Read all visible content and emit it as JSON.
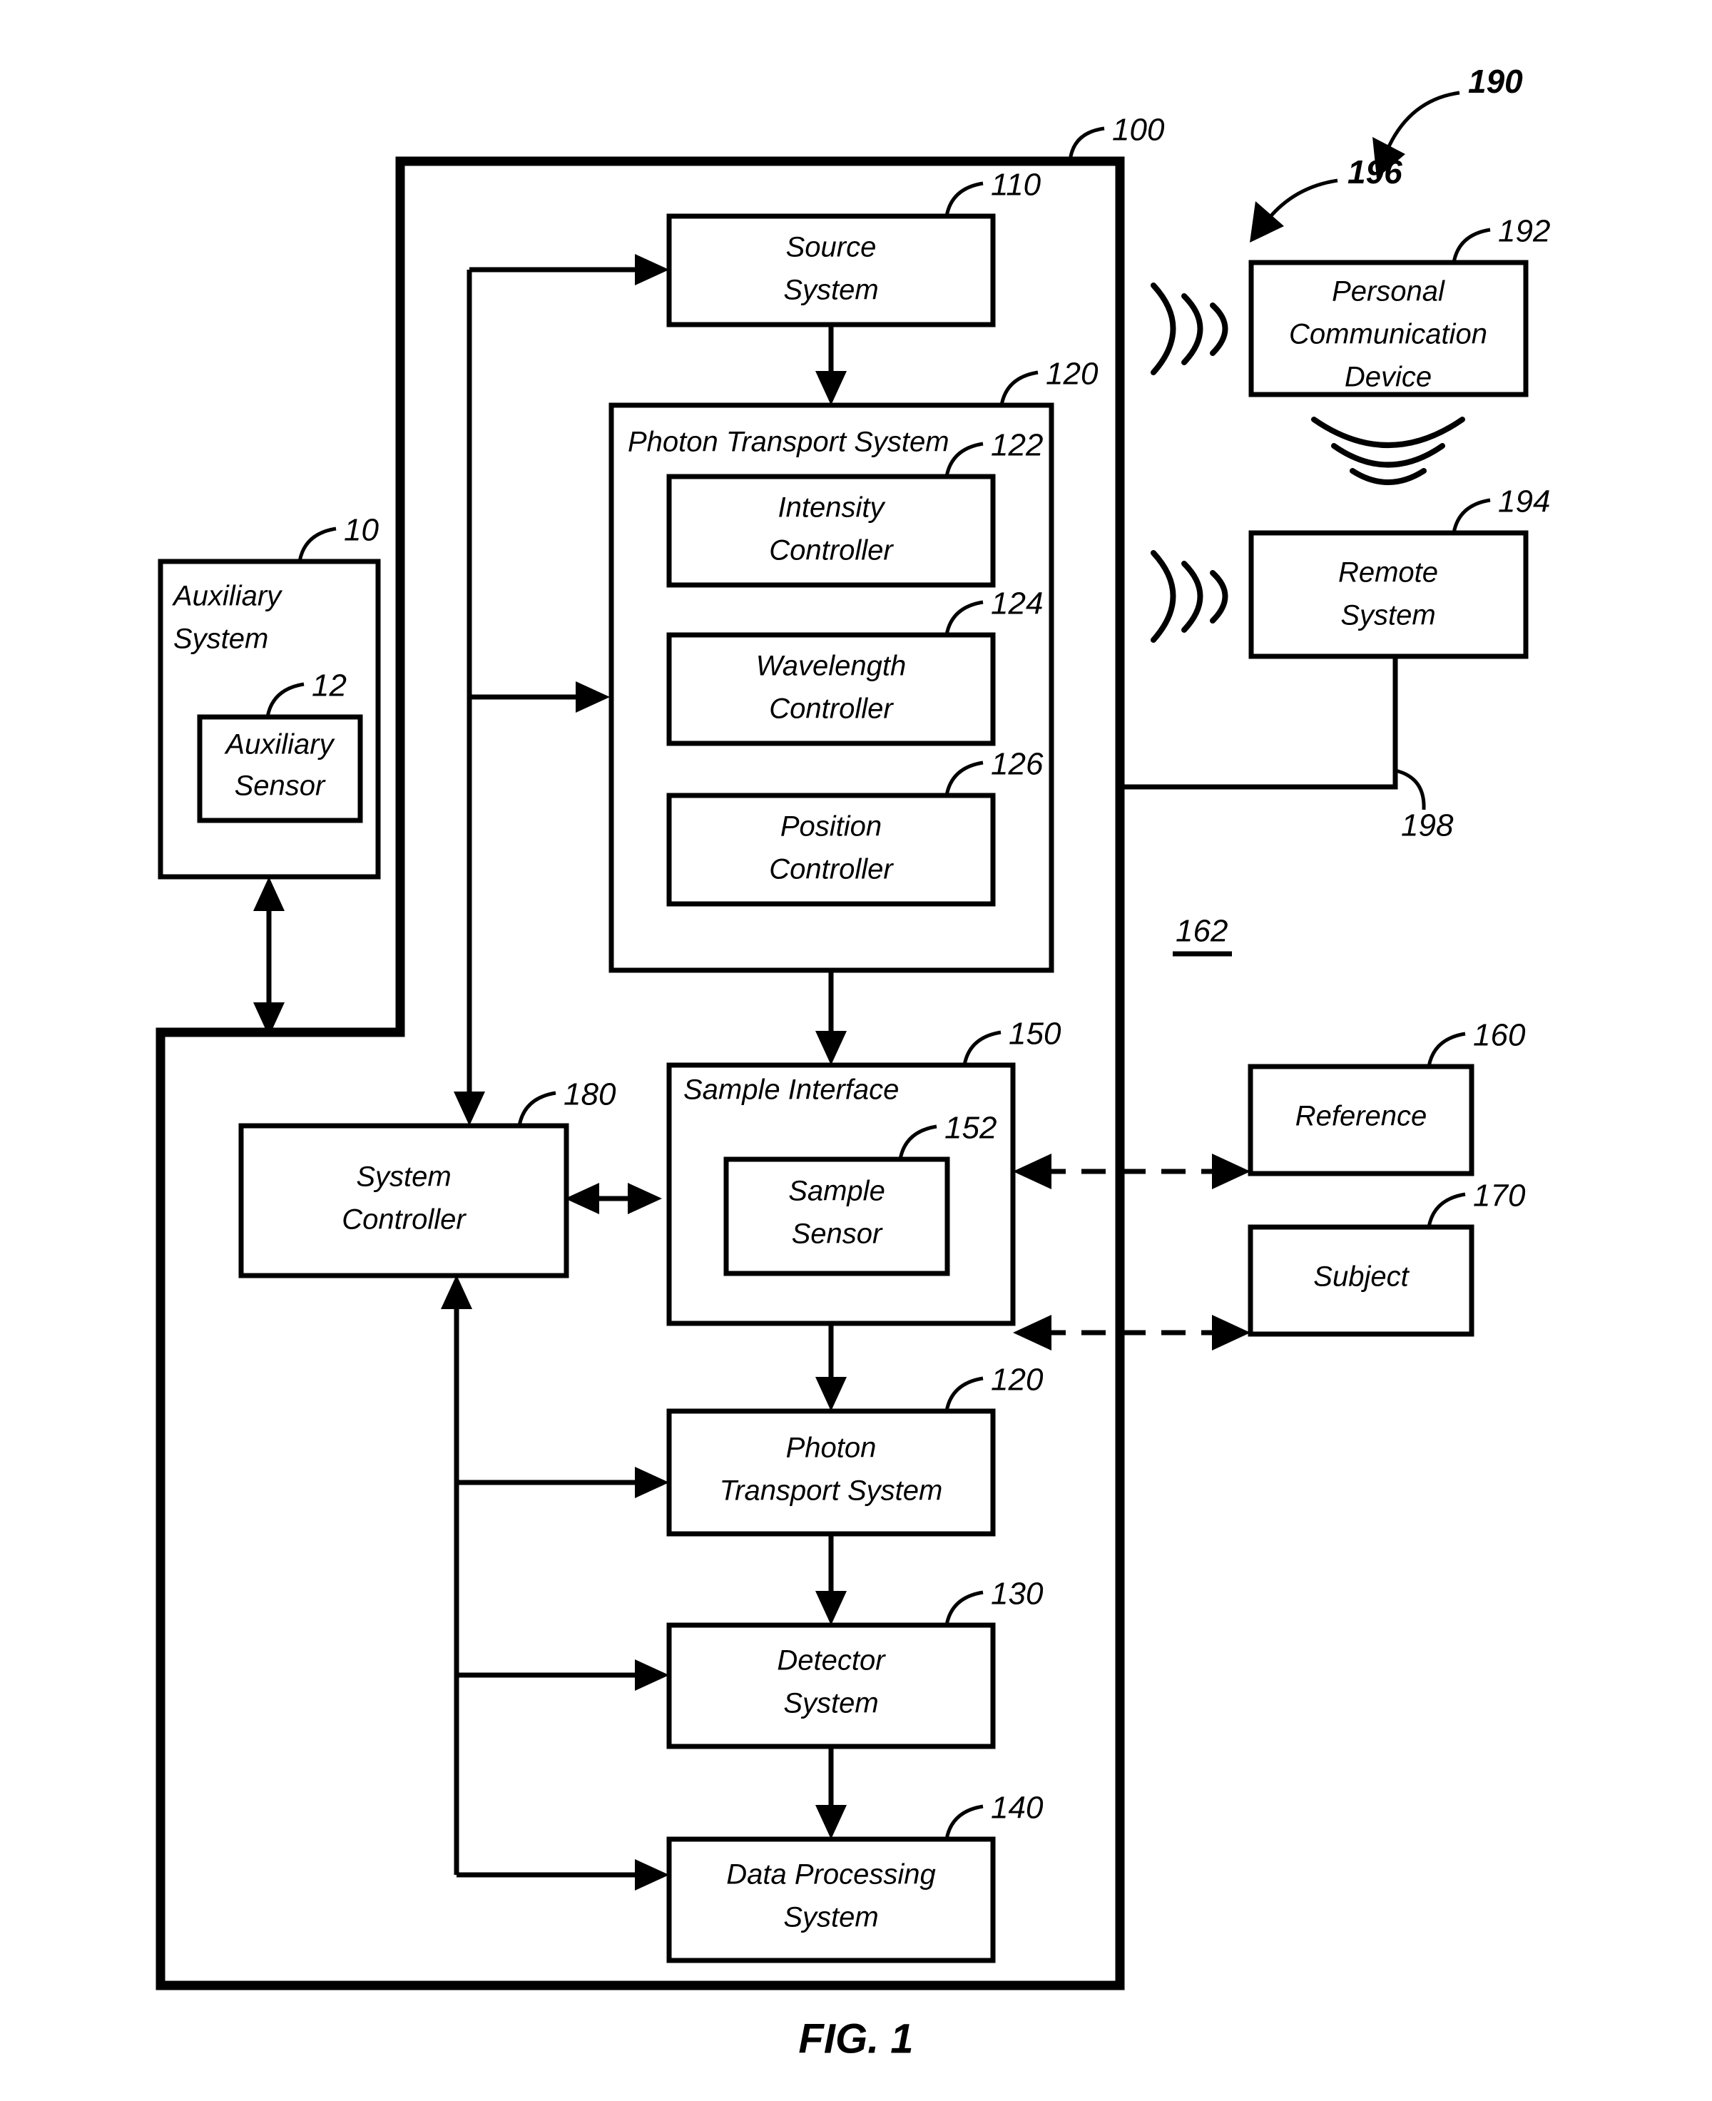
{
  "figure": {
    "caption": "FIG. 1",
    "title_block_100": "100"
  },
  "boxes": {
    "source_system": {
      "line1": "Source",
      "line2": "System",
      "ref": "110"
    },
    "photon_transport_top": {
      "line1": "Photon Transport System",
      "ref": "120"
    },
    "intensity_controller": {
      "line1": "Intensity",
      "line2": "Controller",
      "ref": "122"
    },
    "wavelength_controller": {
      "line1": "Wavelength",
      "line2": "Controller",
      "ref": "124"
    },
    "position_controller": {
      "line1": "Position",
      "line2": "Controller",
      "ref": "126"
    },
    "sample_interface": {
      "line1": "Sample Interface",
      "ref": "150"
    },
    "sample_sensor": {
      "line1": "Sample",
      "line2": "Sensor",
      "ref": "152"
    },
    "system_controller": {
      "line1": "System",
      "line2": "Controller",
      "ref": "180"
    },
    "photon_transport_bot": {
      "line1": "Photon",
      "line2": "Transport System",
      "ref": "120"
    },
    "detector_system": {
      "line1": "Detector",
      "line2": "System",
      "ref": "130"
    },
    "data_processing": {
      "line1": "Data Processing",
      "line2": "System",
      "ref": "140"
    },
    "auxiliary_system": {
      "line1": "Auxiliary",
      "line2": "System",
      "ref": "10"
    },
    "auxiliary_sensor": {
      "line1": "Auxiliary",
      "line2": "Sensor",
      "ref": "12"
    },
    "personal_comm_device": {
      "line1": "Personal",
      "line2": "Communication",
      "line3": "Device",
      "ref": "192"
    },
    "remote_system": {
      "line1": "Remote",
      "line2": "System",
      "ref": "194"
    },
    "reference": {
      "line1": "Reference",
      "ref": "160"
    },
    "subject": {
      "line1": "Subject",
      "ref": "170"
    }
  },
  "refs": {
    "outer_system": "100",
    "comm_group": "190",
    "wireless_link_196": "196",
    "wired_link_198": "198",
    "sample_paths_162": "162"
  }
}
